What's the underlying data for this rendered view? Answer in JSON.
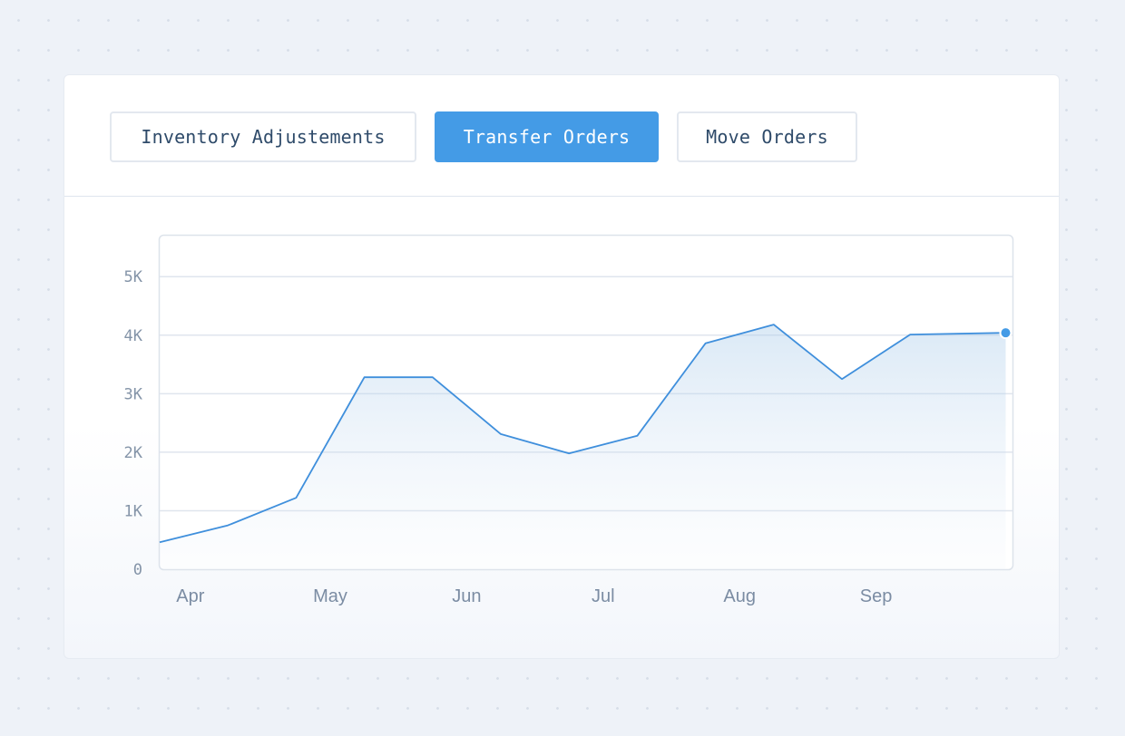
{
  "tabs": [
    {
      "label": "Inventory Adjustements",
      "active": false
    },
    {
      "label": "Transfer Orders",
      "active": true
    },
    {
      "label": "Move Orders",
      "active": false
    }
  ],
  "colors": {
    "accent": "#449be6",
    "line": "#3f8fdc",
    "grid": "#dfe5ee",
    "plot_border": "#dde3eb"
  },
  "chart_data": {
    "type": "area",
    "ylim": [
      0,
      5700
    ],
    "yticks": [
      {
        "value": 0,
        "label": "0"
      },
      {
        "value": 1000,
        "label": "1K"
      },
      {
        "value": 2000,
        "label": "2K"
      },
      {
        "value": 3000,
        "label": "3K"
      },
      {
        "value": 4000,
        "label": "4K"
      },
      {
        "value": 5000,
        "label": "5K"
      }
    ],
    "xlim": [
      0,
      12.5
    ],
    "xticks": [
      {
        "pos": 0.45,
        "label": "Apr"
      },
      {
        "pos": 2.5,
        "label": "May"
      },
      {
        "pos": 4.5,
        "label": "Jun"
      },
      {
        "pos": 6.5,
        "label": "Jul"
      },
      {
        "pos": 8.5,
        "label": "Aug"
      },
      {
        "pos": 10.5,
        "label": "Sep"
      }
    ],
    "grid": true,
    "series": [
      {
        "x": [
          0,
          1,
          2,
          3,
          4,
          5,
          6,
          7,
          8,
          9,
          10,
          11,
          12.4
        ],
        "values": [
          460,
          750,
          1220,
          3280,
          3280,
          2310,
          1980,
          2280,
          3860,
          4180,
          3250,
          4010,
          4040
        ]
      }
    ]
  }
}
